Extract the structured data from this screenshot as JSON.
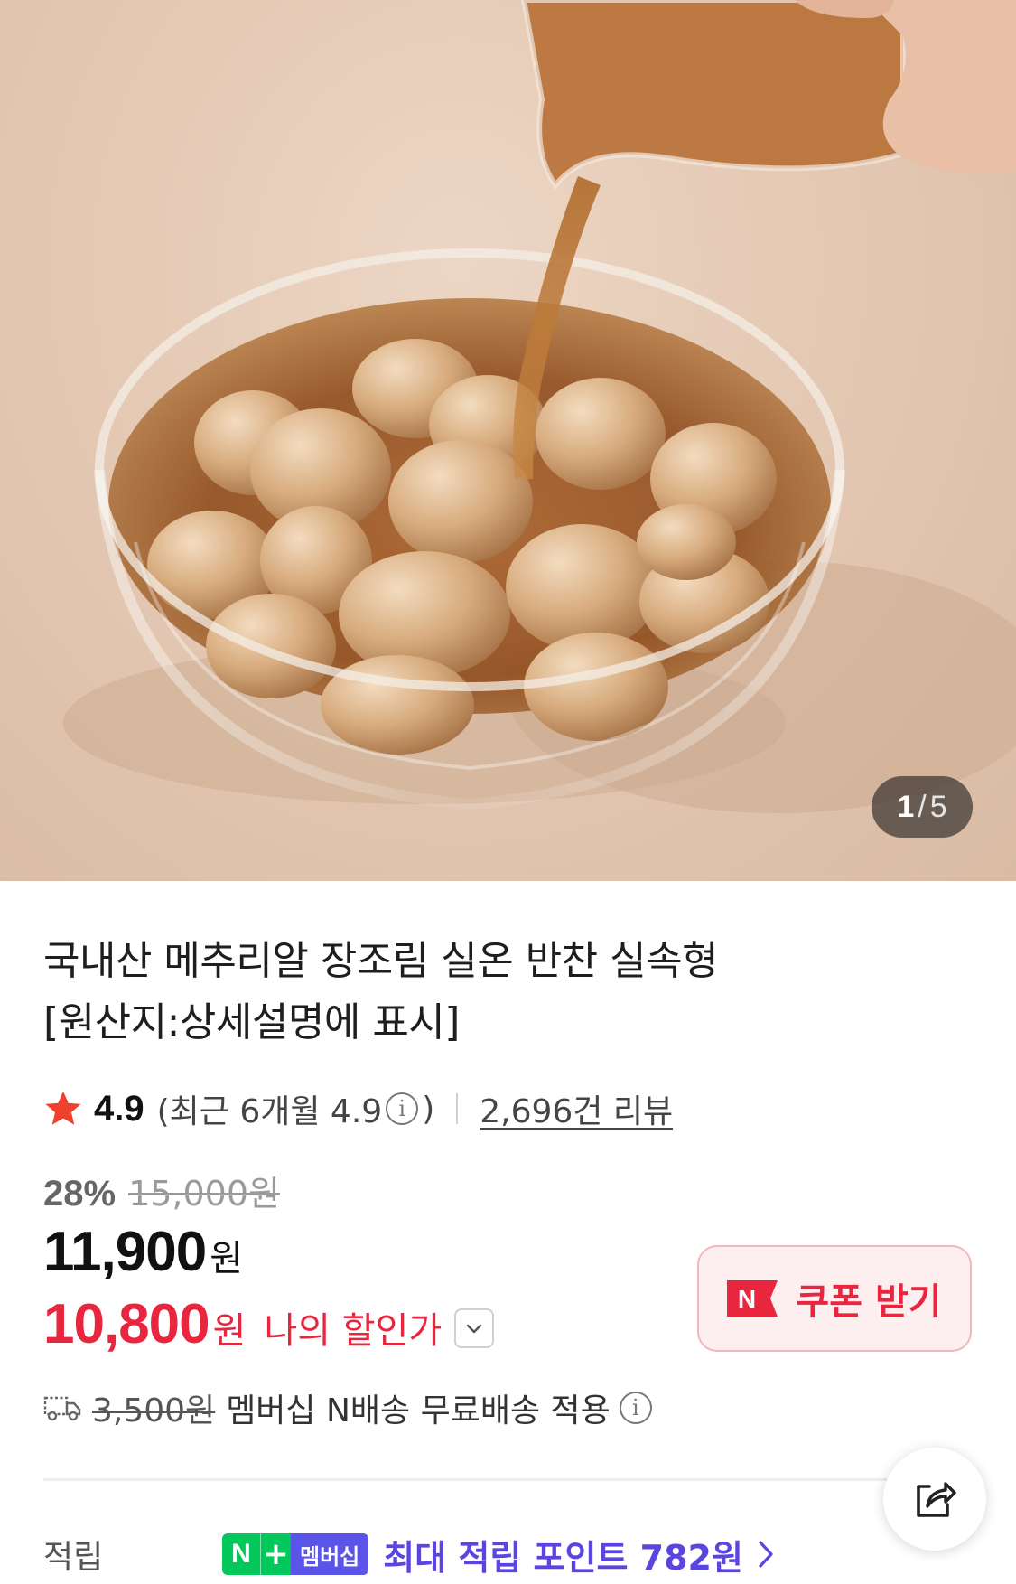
{
  "gallery": {
    "current": "1",
    "separator": "/",
    "total": "5"
  },
  "product": {
    "title_line1": "국내산 메추리알 장조림 실온 반찬 실속형",
    "title_line2": "[원산지:상세설명에 표시]"
  },
  "rating": {
    "score": "4.9",
    "recent_prefix": "(최근 6개월 4.9",
    "recent_suffix": ")",
    "info_glyph": "i",
    "reviews": "2,696건 리뷰",
    "star_color": "#f0412f"
  },
  "price": {
    "discount_rate": "28%",
    "original": "15,000원",
    "sale": "11,900",
    "won": "원",
    "my_price": "10,800",
    "my_won": "원",
    "my_label": "나의 할인가",
    "accent_color": "#e8263e"
  },
  "coupon": {
    "badge": "N",
    "label": "쿠폰 받기"
  },
  "delivery": {
    "old_fee": "3,500원",
    "text": "멤버십 N배송 무료배송 적용",
    "info_glyph": "i"
  },
  "points": {
    "label": "적립",
    "badge_n": "N",
    "badge_plus": "+",
    "badge_text": "멤버십",
    "promo": "최대 적립 포인트 782원",
    "chevron": "›",
    "promo_color": "#5b45e0"
  },
  "icons": {
    "star": "star-icon",
    "info": "info-icon",
    "dropdown": "chevron-down-icon",
    "truck": "truck-icon",
    "share": "share-icon"
  }
}
